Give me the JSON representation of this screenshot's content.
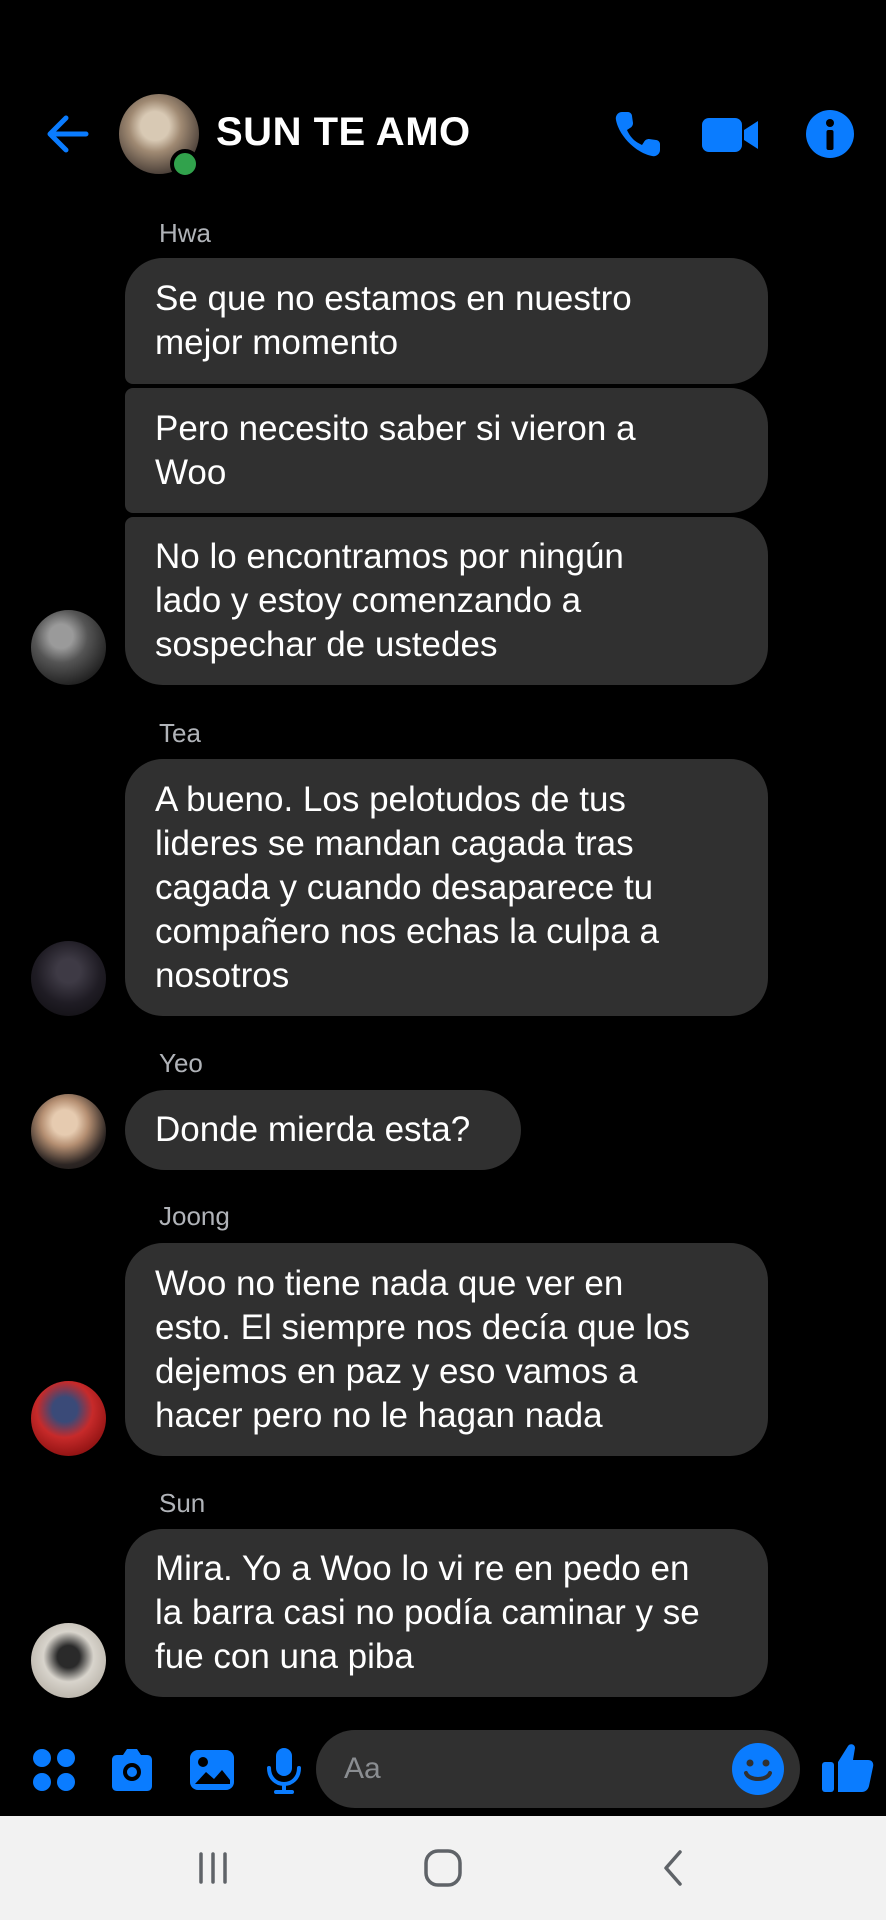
{
  "header": {
    "title": "SUN TE AMO"
  },
  "messages": [
    {
      "sender": "Hwa",
      "bubbles": [
        "Se que no estamos en nuestro\nmejor momento",
        "Pero necesito saber si vieron a\nWoo",
        "No lo encontramos por ningún\nlado y estoy comenzando a\nsospechar de ustedes"
      ]
    },
    {
      "sender": "Tea",
      "bubbles": [
        "A bueno. Los pelotudos de tus\nlideres se mandan cagada tras\ncagada y cuando desaparece tu\ncompañero nos echas la culpa a\nnosotros"
      ]
    },
    {
      "sender": "Yeo",
      "bubbles": [
        "Donde mierda esta?"
      ]
    },
    {
      "sender": "Joong",
      "bubbles": [
        "Woo no tiene nada que ver en\nesto. El siempre nos decía que los\ndejemos en paz y eso vamos a\nhacer pero no le hagan nada"
      ]
    },
    {
      "sender": "Sun",
      "bubbles": [
        "Mira. Yo a Woo lo vi re en pedo en\nla barra casi no podía caminar y se\nfue con una piba"
      ]
    }
  ],
  "composer": {
    "placeholder": "Aa"
  },
  "colors": {
    "accent": "#0a7cff",
    "bubble": "#303030",
    "background": "#000000",
    "online": "#31a24c"
  },
  "icons": {
    "header": [
      "back-arrow-icon",
      "phone-icon",
      "video-camera-icon",
      "info-icon"
    ],
    "composer": [
      "apps-grid-icon",
      "camera-icon",
      "gallery-icon",
      "microphone-icon",
      "emoji-icon",
      "thumbs-up-icon"
    ],
    "navbar": [
      "recent-apps-icon",
      "home-icon",
      "back-nav-icon"
    ]
  }
}
